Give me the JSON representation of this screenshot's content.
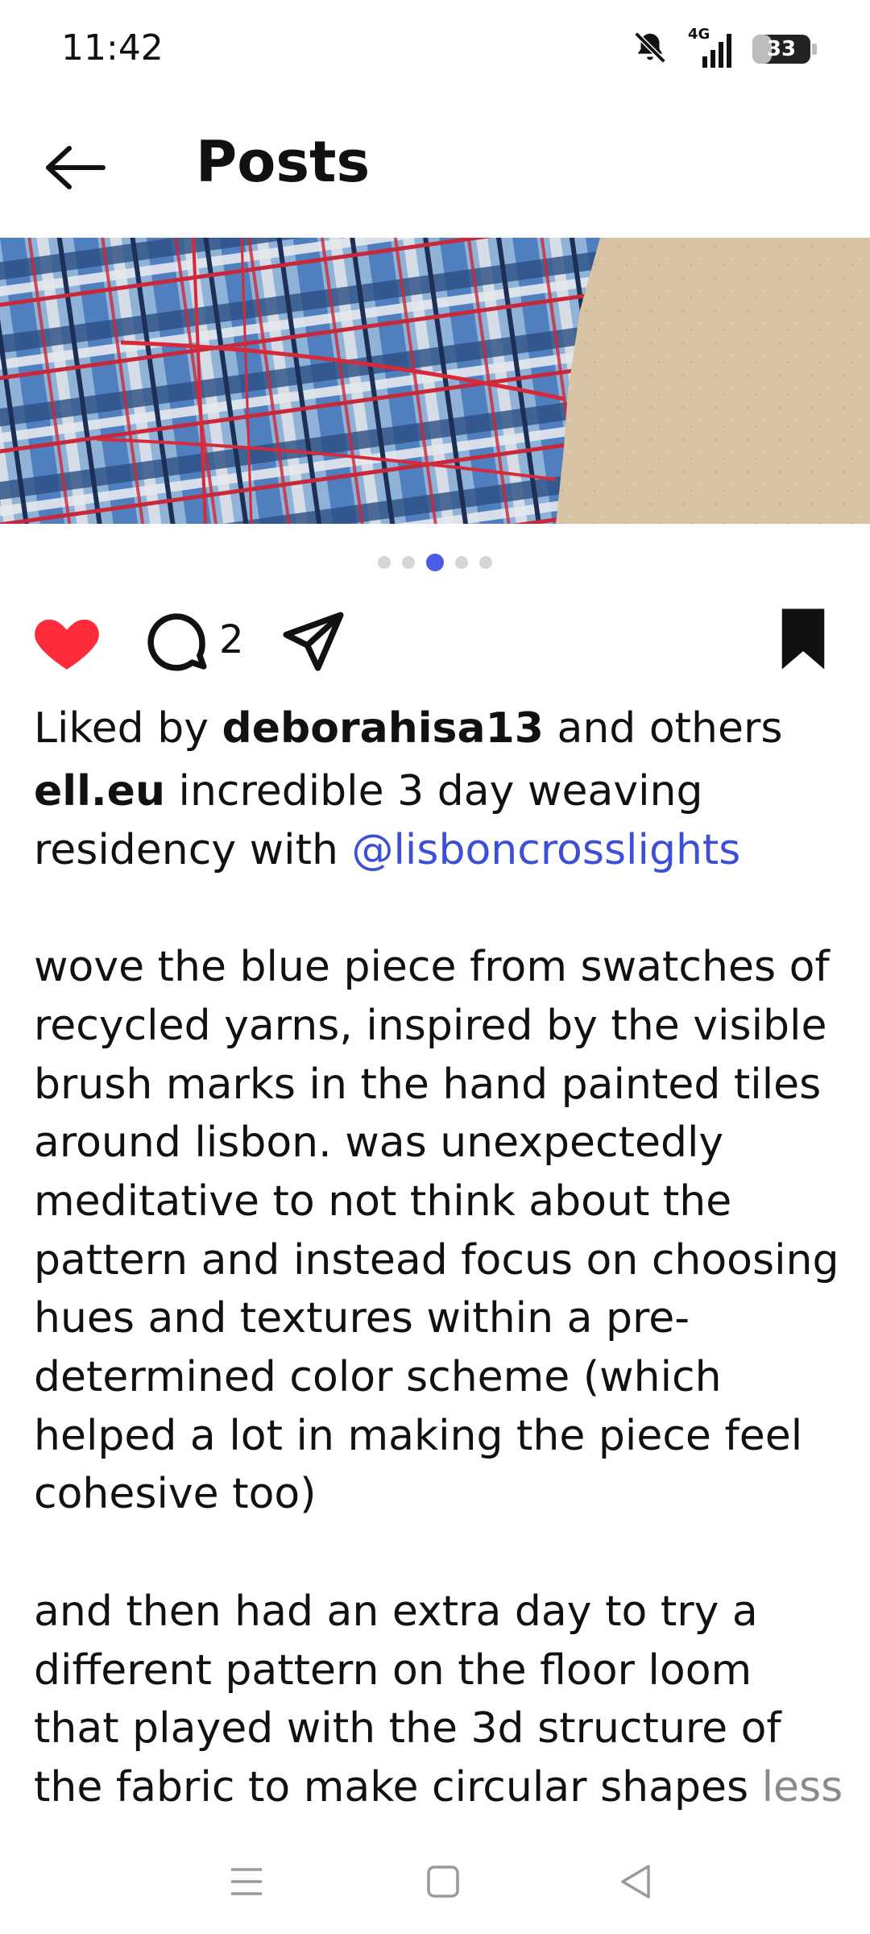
{
  "status_bar": {
    "time": "11:42",
    "network": "4G",
    "battery": "33",
    "battery_level": 0.33
  },
  "header": {
    "title": "Posts",
    "back_icon": "arrow-left-icon"
  },
  "carousel": {
    "page_count": 5,
    "active_index": 2
  },
  "actions": {
    "like_icon": "heart-filled-icon",
    "comment_icon": "comment-icon",
    "comment_count": "2",
    "share_icon": "send-icon",
    "save_icon": "bookmark-filled-icon",
    "like_color": "#fe2c3b"
  },
  "likes": {
    "prefix": "Liked by ",
    "user": "deborahisa13",
    "suffix": " and others"
  },
  "caption": {
    "author": "ell.eu",
    "text_1": " incredible 3 day weaving residency with ",
    "mention": "@lisboncrosslights",
    "text_2": "\n\nwove the blue piece from swatches of recycled yarns, inspired by the visible brush marks in the hand painted tiles around lisbon. was unexpectedly meditative to not think about the pattern and instead focus on choosing hues and textures within a pre-determined color scheme (which helped a lot in making the piece feel cohesive too)\n\nand then had an extra day to try a different pattern on the floor loom that played with the 3d structure of the fabric to make circular shapes ",
    "more_label": "less"
  },
  "nav_bar": {
    "menu_icon": "menu-icon",
    "home_icon": "square-home-icon",
    "back_icon": "triangle-back-icon"
  },
  "colors": {
    "accent": "#4a5ce8",
    "mention": "#3d4fd6"
  }
}
